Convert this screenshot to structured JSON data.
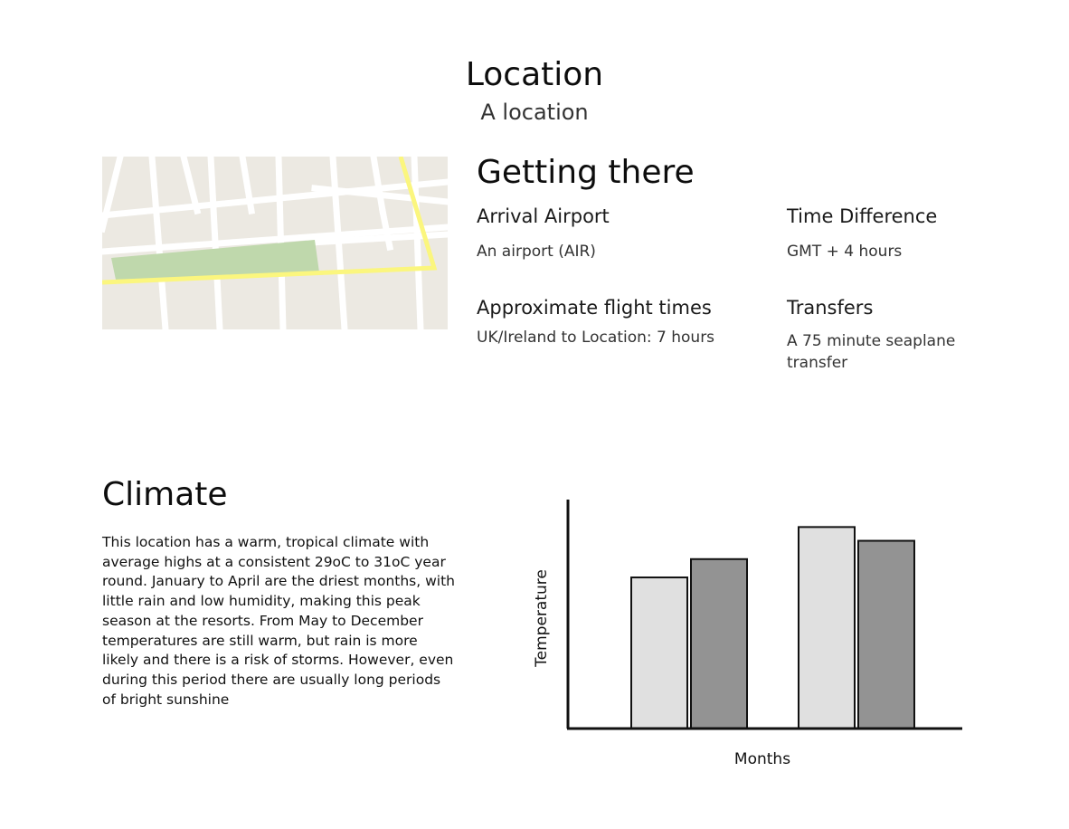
{
  "header": {
    "title": "Location",
    "subtitle": "A location"
  },
  "map": {
    "icon": "map-thumbnail",
    "colors": {
      "land": "#ece9e2",
      "road": "#ffffff",
      "highway": "#fbf67e",
      "park": "#bfd8ac"
    }
  },
  "getting_there": {
    "title": "Getting there",
    "arrival_airport": {
      "label": "Arrival Airport",
      "value": "An airport (AIR)"
    },
    "time_difference": {
      "label": "Time Difference",
      "value": "GMT + 4 hours"
    },
    "flight_times": {
      "label": "Approximate flight times",
      "value": "UK/Ireland to Location: 7 hours"
    },
    "transfers": {
      "label": "Transfers",
      "value": "A 75 minute seaplane transfer"
    }
  },
  "climate": {
    "title": "Climate",
    "description": "This location has a warm, tropical climate with average highs at a consistent 29oC to 31oC year round. January to April are the driest months, with little rain and low humidity, making this peak season at the resorts. From May to December temperatures are still warm, but rain is more likely and there is a risk of storms. However, even during this period there are usually long periods of bright sunshine"
  },
  "chart_data": {
    "type": "bar",
    "categories": [
      "",
      ""
    ],
    "series": [
      {
        "values": [
          66,
          88
        ],
        "color": "#e0e0e0"
      },
      {
        "values": [
          74,
          82
        ],
        "color": "#939393"
      }
    ],
    "xlabel": "Months",
    "ylabel": "Temperature",
    "ylim": [
      0,
      100
    ],
    "grid": false,
    "legend": "none"
  }
}
